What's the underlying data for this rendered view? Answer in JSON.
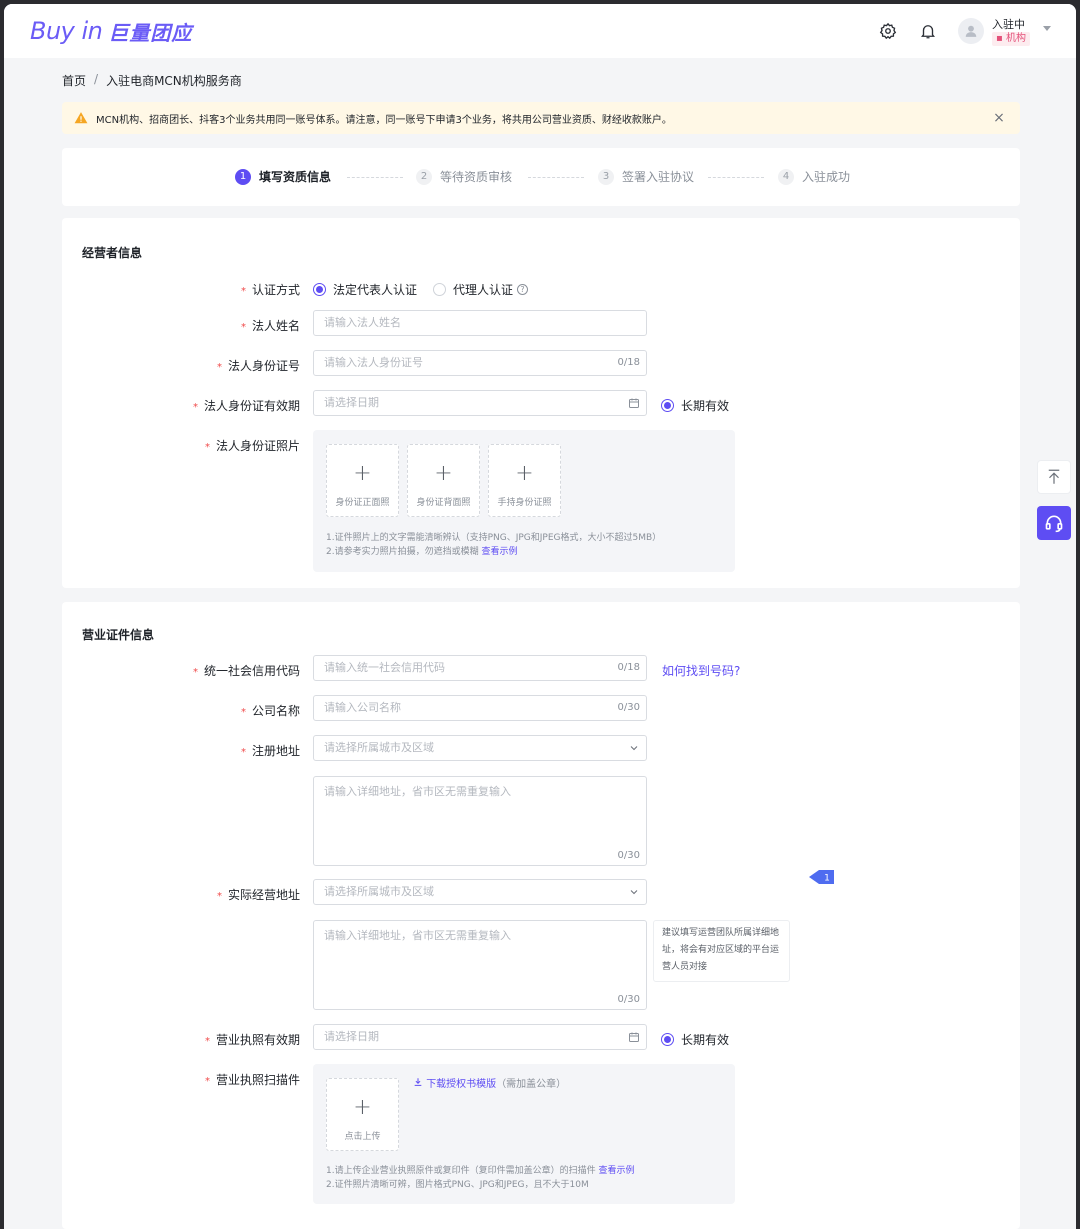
{
  "header": {
    "logo_latin": "Buy in",
    "logo_cn": "巨量团应",
    "user_name": "入驻中",
    "user_role": "机构",
    "icons": [
      "gear-icon",
      "bell-icon",
      "user-icon",
      "caret-down-icon"
    ]
  },
  "breadcrumb": {
    "home": "首页",
    "sep": "/",
    "current": "入驻电商MCN机构服务商"
  },
  "alert": {
    "text": "MCN机构、招商团长、抖客3个业务共用同一账号体系。请注意，同一账号下申请3个业务，将共用公司营业资质、财经收款账户。"
  },
  "steps": [
    {
      "num": "1",
      "label": "填写资质信息",
      "active": true
    },
    {
      "num": "2",
      "label": "等待资质审核",
      "active": false
    },
    {
      "num": "3",
      "label": "签署入驻协议",
      "active": false
    },
    {
      "num": "4",
      "label": "入驻成功",
      "active": false
    }
  ],
  "operator": {
    "title": "经营者信息",
    "auth_label": "认证方式",
    "auth_opt1": "法定代表人认证",
    "auth_opt2": "代理人认证",
    "auth_help": "?",
    "name_label": "法人姓名",
    "name_placeholder": "请输入法人姓名",
    "id_label": "法人身份证号",
    "id_placeholder": "请输入法人身份证号",
    "id_count": "0/18",
    "validity_label": "法人身份证有效期",
    "validity_placeholder": "请选择日期",
    "long_term": "长期有效",
    "photo_label": "法人身份证照片",
    "upload_plus": "+",
    "upload1": "身份证正面照",
    "upload2": "身份证背面照",
    "upload3": "手持身份证照",
    "tip1": "1.证件照片上的文字需能清晰辨认（支持PNG、JPG和JPEG格式，大小不超过5MB）",
    "tip2": "2.请参考实力照片拍摄，勿遮挡或模糊",
    "tip2_link": "查看示例"
  },
  "license": {
    "title": "营业证件信息",
    "credit_label": "统一社会信用代码",
    "credit_placeholder": "请输入统一社会信用代码",
    "credit_count": "0/18",
    "credit_link": "如何找到号码?",
    "company_label": "公司名称",
    "company_placeholder": "请输入公司名称",
    "company_count": "0/30",
    "reg_label": "注册地址",
    "region_placeholder": "请选择所属城市及区域",
    "detail_placeholder": "请输入详细地址，省市区无需重复输入",
    "detail_count": "0/30",
    "biz_label": "实际经营地址",
    "biz_region_placeholder": "请选择所属城市及区域",
    "biz_detail_placeholder": "请输入详细地址，省市区无需重复输入",
    "biz_detail_count": "0/30",
    "biz_tip": "建议填写运营团队所属详细地址，将会有对应区域的平台运营人员对接",
    "validity_label": "营业执照有效期",
    "validity_placeholder": "请选择日期",
    "long_term": "长期有效",
    "scan_label": "营业执照扫描件",
    "download_link": "下载授权书模版",
    "download_note": "（需加盖公章）",
    "upload_plus": "+",
    "upload_cap": "点击上传",
    "tip1": "1.请上传企业营业执照原件或复印件（复印件需加盖公章）的扫描件",
    "tip1_link": "查看示例",
    "tip2": "2.证件照片清晰可辨，图片格式PNG、JPG和JPEG，且不大于10M"
  },
  "float": {
    "marker_num": "1",
    "icons": [
      "back-to-top-icon",
      "headset-icon"
    ]
  },
  "colors": {
    "brand": "#5e4df3",
    "required": "#f04a4a",
    "alert_bg": "#fff8e6",
    "role_text": "#e4517a"
  }
}
